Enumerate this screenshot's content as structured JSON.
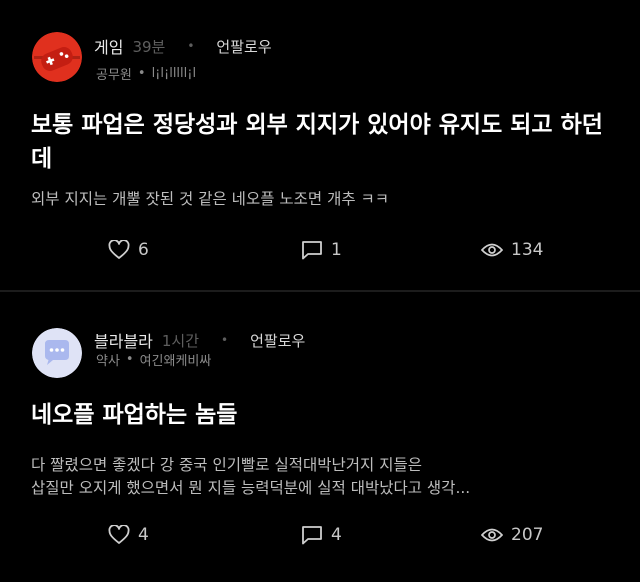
{
  "posts": [
    {
      "board": "게임",
      "time": "39분",
      "dot": "•",
      "follow": "언팔로우",
      "company": "공무원",
      "user_sep": "•",
      "nickname": "l¡l¡lllll¡l",
      "title": "보통 파업은 정당성과 외부 지지가 있어야 유지도 되고 하던데",
      "body": "외부 지지는 개뿔 잣된 것 같은 네오플 노조면 개추 ㅋㅋ",
      "likes": "6",
      "comments": "1",
      "views": "134",
      "avatar_icon": "game-controller-icon",
      "avatar_color": "#e0301e"
    },
    {
      "board": "블라블라",
      "time": "1시간",
      "dot": "•",
      "follow": "언팔로우",
      "company": "약사",
      "user_sep": "•",
      "nickname": "여긴왜케비싸",
      "title": "네오플 파업하는 놈들",
      "body": "다 짤렸으면 좋겠다  강 중국 인기빨로 실적대박난거지 지들은\n삽질만 오지게 했으면서 뭔 지들 능력덕분에 실적 대박났다고 생각...",
      "likes": "4",
      "comments": "4",
      "views": "207",
      "avatar_icon": "chat-bubble-icon",
      "avatar_color": "#dfe3f6"
    }
  ],
  "icons": {
    "like": "heart-icon",
    "comment": "comment-icon",
    "view": "eye-icon"
  }
}
